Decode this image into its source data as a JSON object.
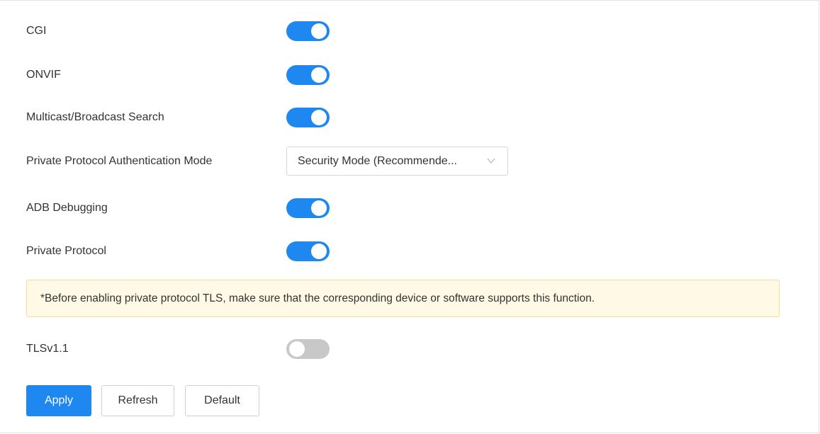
{
  "settings": {
    "cgi": {
      "label": "CGI",
      "enabled": true
    },
    "onvif": {
      "label": "ONVIF",
      "enabled": true
    },
    "multicast": {
      "label": "Multicast/Broadcast Search",
      "enabled": true
    },
    "auth_mode": {
      "label": "Private Protocol Authentication Mode",
      "value": "Security Mode (Recommende..."
    },
    "adb": {
      "label": "ADB Debugging",
      "enabled": true
    },
    "private_protocol": {
      "label": "Private Protocol",
      "enabled": true
    },
    "tls11": {
      "label": "TLSv1.1",
      "enabled": false
    }
  },
  "notice": {
    "text": "*Before enabling private protocol TLS, make sure that the corresponding device or software supports this function."
  },
  "actions": {
    "apply": "Apply",
    "refresh": "Refresh",
    "default": "Default"
  },
  "colors": {
    "accent": "#1e88f0",
    "toggle_off": "#c8c8c8",
    "notice_bg": "#fff9e5",
    "notice_border": "#f3dd9a"
  },
  "icons": {
    "select_indicator": "chevron-down-icon"
  }
}
